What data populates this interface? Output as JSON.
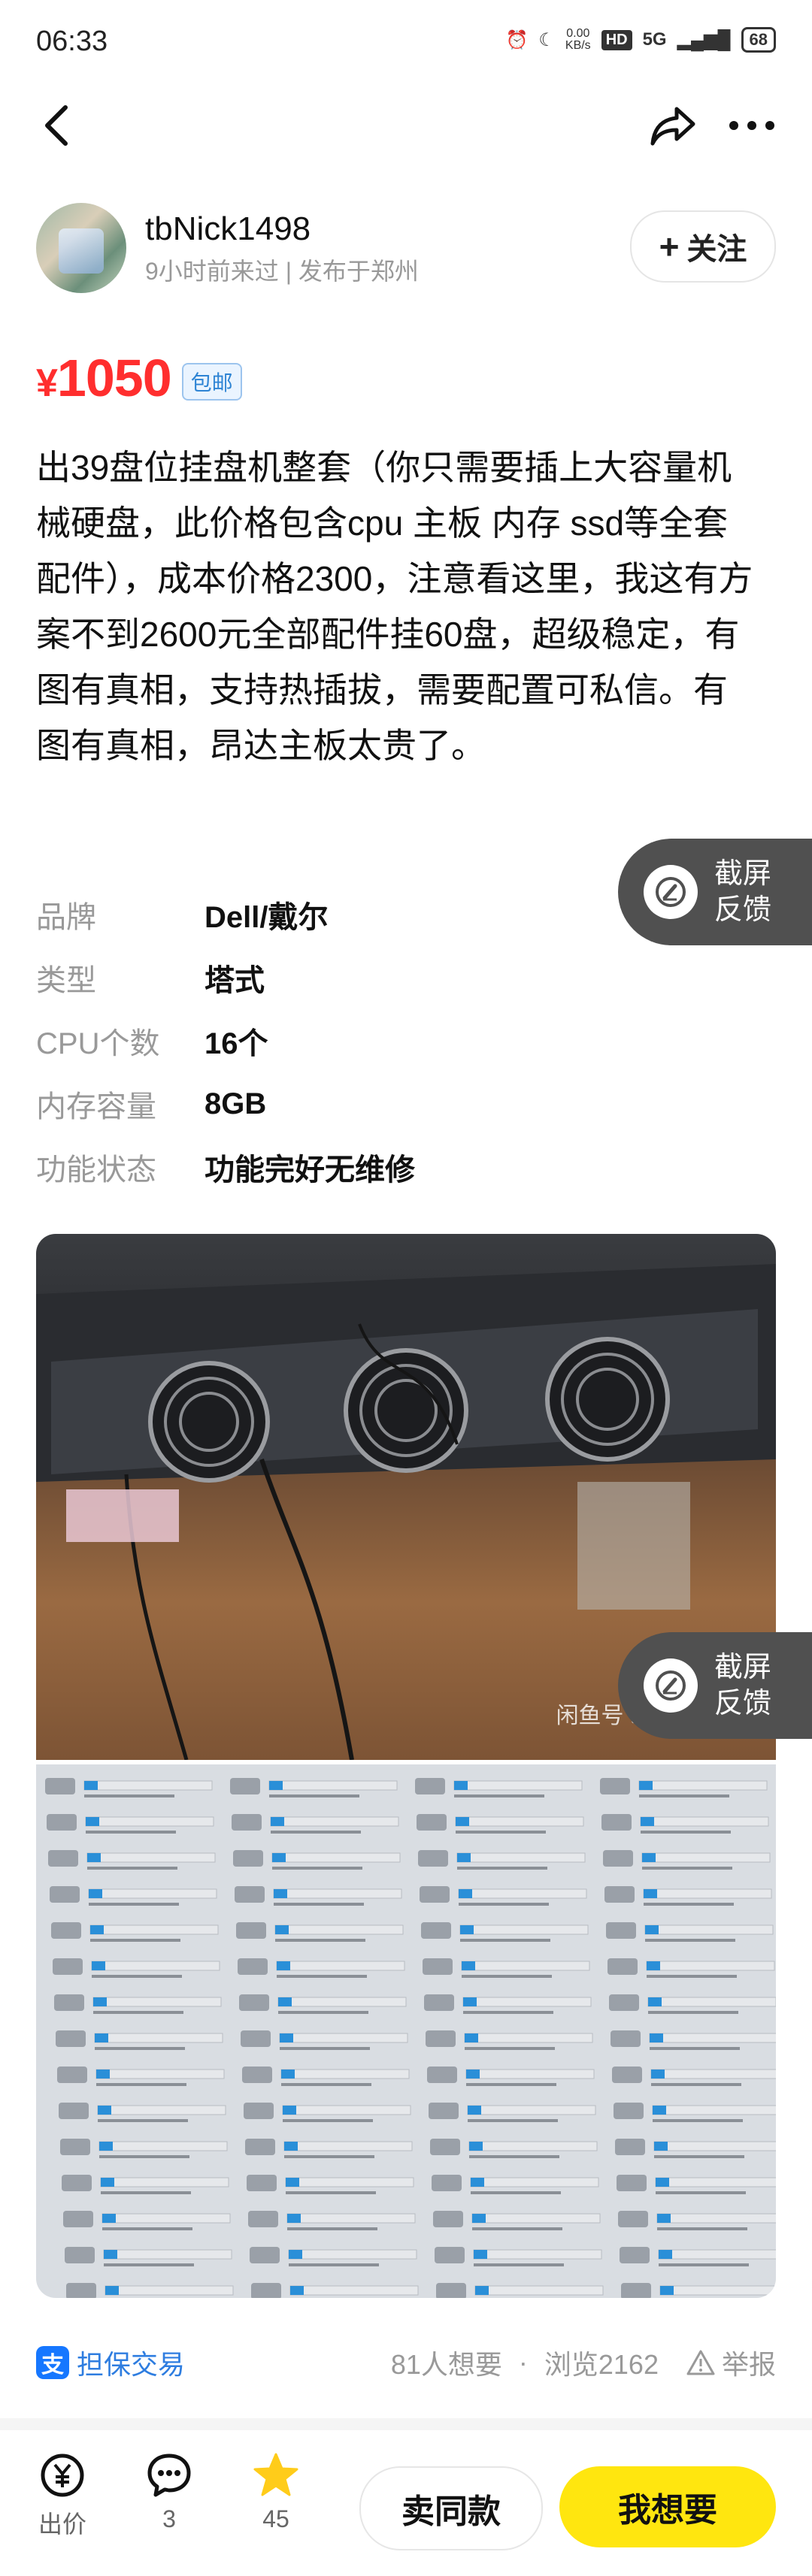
{
  "status_bar": {
    "time": "06:33",
    "net_speed": "0.00\nKB/s",
    "network": "5G",
    "battery": "68"
  },
  "seller": {
    "name": "tbNick1498",
    "meta": "9小时前来过 | 发布于郑州",
    "follow_label": "关注"
  },
  "price": {
    "symbol": "¥",
    "value": "1050",
    "badge": "包邮"
  },
  "description": "出39盘位挂盘机整套（你只需要插上大容量机械硬盘，此价格包含cpu 主板 内存 ssd等全套配件），成本价格2300，注意看这里，我这有方案不到2600元全部配件挂60盘，超级稳定，有图有真相，支持热插拔，需要配置可私信。有图有真相，昂达主板太贵了。",
  "specs": [
    {
      "label": "品牌",
      "value": "Dell/戴尔"
    },
    {
      "label": "类型",
      "value": "塔式"
    },
    {
      "label": "CPU个数",
      "value": "16个"
    },
    {
      "label": "内存容量",
      "value": "8GB"
    },
    {
      "label": "功能状态",
      "value": "功能完好无维修"
    }
  ],
  "feedback": {
    "line1": "截屏",
    "line2": "反馈"
  },
  "photo_watermark": "闲鱼号 tbNick1498",
  "trade": {
    "label": "担保交易",
    "wants": "81人想要",
    "views": "浏览2162",
    "report": "举报",
    "dot": "·"
  },
  "bottom_bar": {
    "bid_label": "出价",
    "comment_count": "3",
    "fav_count": "45",
    "same_button": "卖同款",
    "want_button": "我想要"
  },
  "colors": {
    "price": "#ff2e2e",
    "want_button": "#ffe60f",
    "feedback_bg": "#505050",
    "link_blue": "#2e7de0",
    "star": "#ffcc1a"
  }
}
